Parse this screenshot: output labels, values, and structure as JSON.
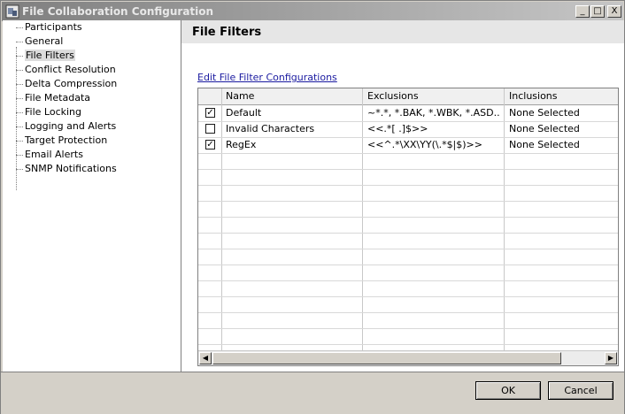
{
  "window": {
    "title": "File Collaboration Configuration"
  },
  "sidebar": {
    "items": [
      {
        "label": "Participants"
      },
      {
        "label": "General"
      },
      {
        "label": "File Filters",
        "selected": true
      },
      {
        "label": "Conflict Resolution"
      },
      {
        "label": "Delta Compression"
      },
      {
        "label": "File Metadata"
      },
      {
        "label": "File Locking"
      },
      {
        "label": "Logging and Alerts"
      },
      {
        "label": "Target Protection"
      },
      {
        "label": "Email Alerts"
      },
      {
        "label": "SNMP Notifications"
      }
    ]
  },
  "main": {
    "title": "File Filters",
    "edit_link": "Edit File Filter Configurations",
    "table": {
      "columns": [
        "Name",
        "Exclusions",
        "Inclusions"
      ],
      "rows": [
        {
          "checked": true,
          "name": "Default",
          "exclusions": "~*.*, *.BAK, *.WBK, *.ASD...",
          "inclusions": "None Selected"
        },
        {
          "checked": false,
          "name": "Invalid Characters",
          "exclusions": "<<.*[ .]$>>",
          "inclusions": "None Selected"
        },
        {
          "checked": true,
          "name": "RegEx",
          "exclusions": "<<^.*\\XX\\YY(\\.*$|$)>>",
          "inclusions": "None Selected"
        }
      ]
    }
  },
  "buttons": {
    "ok": "OK",
    "cancel": "Cancel"
  },
  "titlebar_buttons": {
    "minimize": "_",
    "maximize": "□",
    "close": "X"
  }
}
